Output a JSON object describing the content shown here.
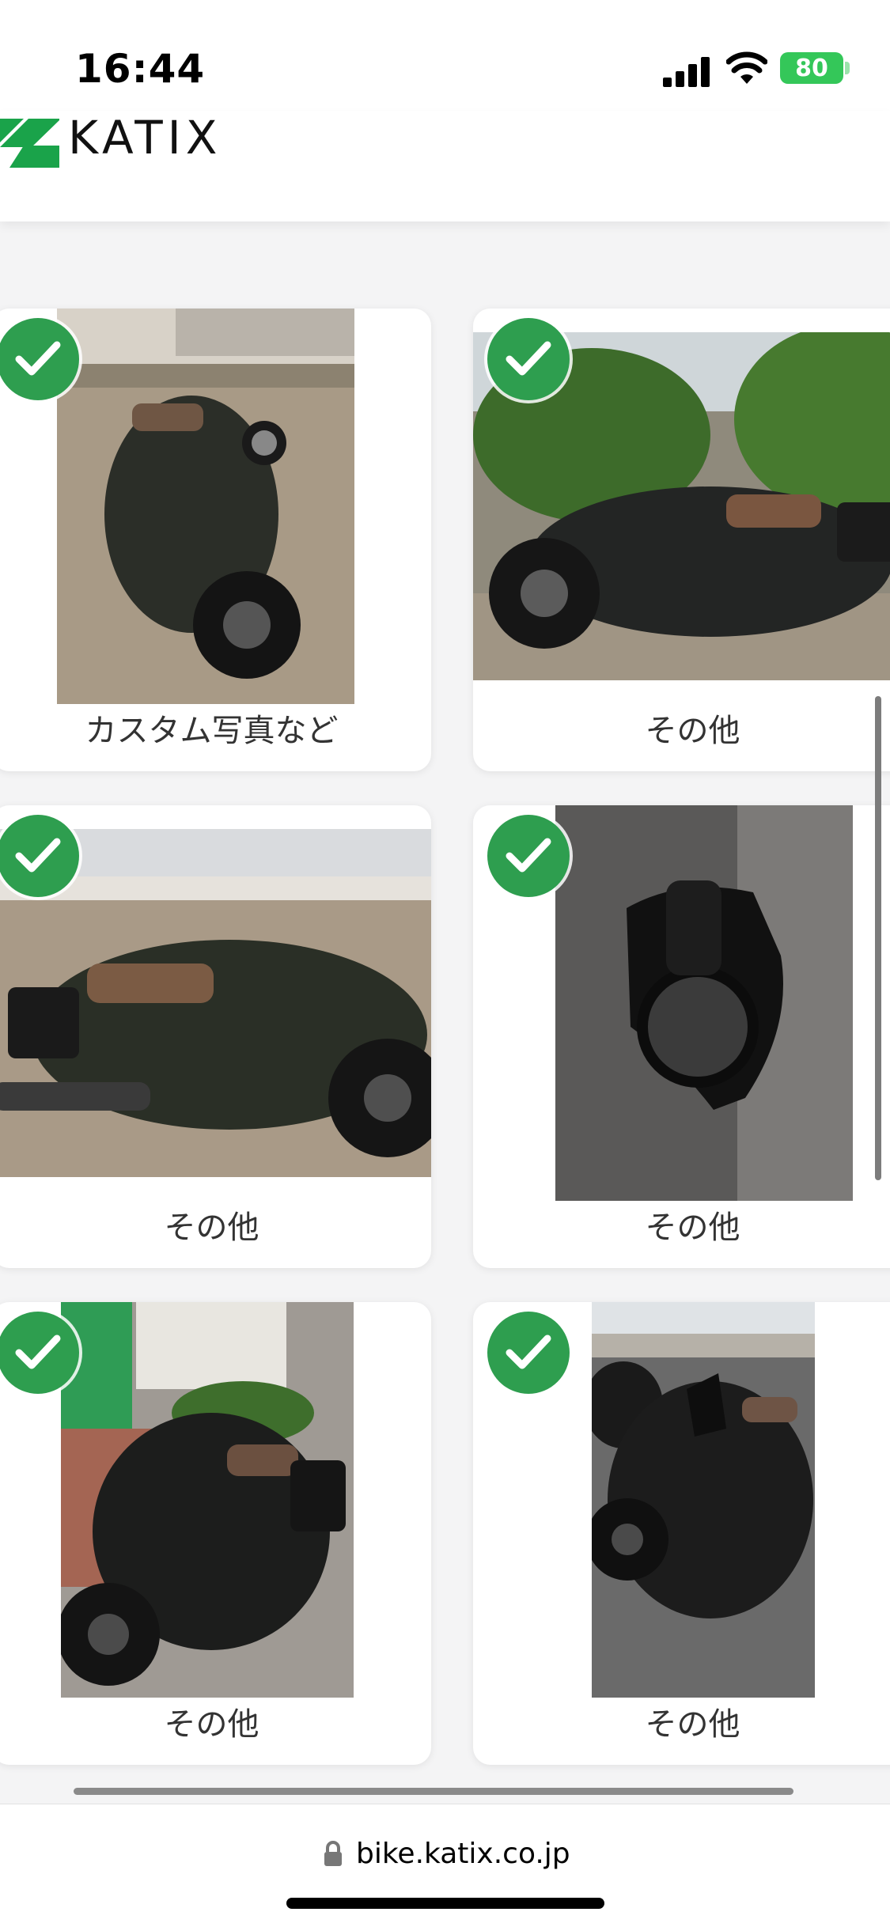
{
  "status_bar": {
    "time": "16:44",
    "battery": "80",
    "icons": [
      "signal-icon",
      "wifi-icon",
      "battery-icon"
    ]
  },
  "header": {
    "brand": "KATIX",
    "logo_color": "#1aa34a"
  },
  "photos": [
    {
      "caption": "カスタム写真など",
      "selected": true
    },
    {
      "caption": "その他",
      "selected": true
    },
    {
      "caption": "その他",
      "selected": true
    },
    {
      "caption": "その他",
      "selected": true
    },
    {
      "caption": "その他",
      "selected": true
    },
    {
      "caption": "その他",
      "selected": true
    }
  ],
  "address_bar": {
    "url": "bike.katix.co.jp"
  },
  "colors": {
    "check_green": "#2e9e4f",
    "battery_green": "#34c759"
  }
}
